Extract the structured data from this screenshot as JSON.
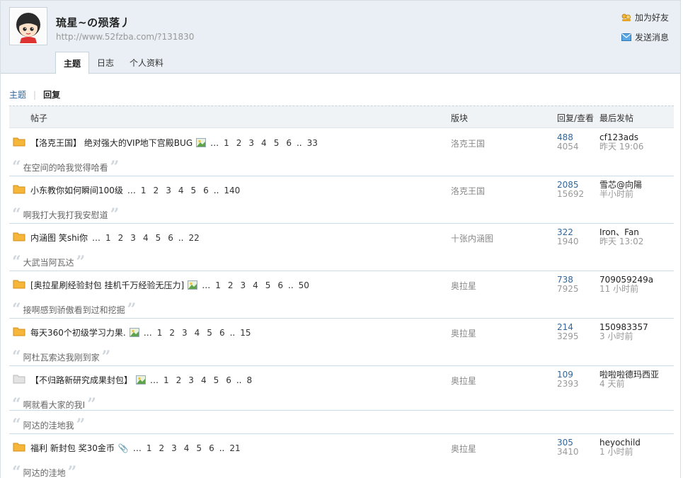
{
  "user": {
    "name": "琉星~の殒落丿",
    "url": "http://www.52fzba.com/?131830",
    "add_friend": "加为好友",
    "send_message": "发送消息"
  },
  "tabs": [
    "主题",
    "日志",
    "个人资料"
  ],
  "subnav": {
    "topics": "主题",
    "replies": "回复"
  },
  "table": {
    "headers": {
      "post": "帖子",
      "forum": "版块",
      "reply_view": "回复/查看",
      "last_post": "最后发帖"
    },
    "rows": [
      {
        "title": "【洛克王国】 绝对强大的VIP地下宫殿BUG",
        "has_image": true,
        "has_attach": false,
        "pages": [
          "1",
          "2",
          "3",
          "4",
          "5",
          "6"
        ],
        "last_page": "33",
        "forum": "洛克王国",
        "replies": "488",
        "views": "4054",
        "last_user": "cf123ads",
        "last_time": "昨天 19:06",
        "quotes": [
          "在空间的哈我觉得哈看"
        ]
      },
      {
        "title": "小东教你如何瞬间100级",
        "has_image": false,
        "has_attach": false,
        "pages": [
          "1",
          "2",
          "3",
          "4",
          "5",
          "6"
        ],
        "last_page": "140",
        "forum": "洛克王国",
        "replies": "2085",
        "views": "15692",
        "last_user": "雪芯@向陽",
        "last_time": "半小时前",
        "quotes": [
          "啊我打大我打我安慰道"
        ]
      },
      {
        "title": "内涵图 笑shi你",
        "has_image": false,
        "has_attach": false,
        "pages": [
          "1",
          "2",
          "3",
          "4",
          "5",
          "6"
        ],
        "last_page": "22",
        "forum": "十张内涵图",
        "replies": "322",
        "views": "1940",
        "last_user": "Iron、Fan",
        "last_time": "昨天 13:02",
        "quotes": [
          "大武当阿瓦达"
        ]
      },
      {
        "title": "[奥拉星刷经验封包 挂机千万经验无压力]",
        "has_image": true,
        "has_attach": false,
        "pages": [
          "1",
          "2",
          "3",
          "4",
          "5",
          "6"
        ],
        "last_page": "50",
        "forum": "奥拉星",
        "replies": "738",
        "views": "7925",
        "last_user": "709059249a",
        "last_time": "11 小时前",
        "quotes": [
          "接啊感到骄傲看到过和挖掘"
        ]
      },
      {
        "title": "每天360个初级学习力果.",
        "has_image": true,
        "has_attach": false,
        "pages": [
          "1",
          "2",
          "3",
          "4",
          "5",
          "6"
        ],
        "last_page": "15",
        "forum": "奥拉星",
        "replies": "214",
        "views": "3295",
        "last_user": "150983357",
        "last_time": "3 小时前",
        "quotes": [
          "阿杜瓦索达我刚到家"
        ]
      },
      {
        "title": "【不归路新研究成果封包】",
        "has_image": true,
        "has_attach": false,
        "pages": [
          "1",
          "2",
          "3",
          "4",
          "5",
          "6"
        ],
        "last_page": "8",
        "forum": "奥拉星",
        "replies": "109",
        "views": "2393",
        "last_user": "啦啦啦德玛西亚",
        "last_time": "4 天前",
        "quotes": [
          "啊就看大家的我I",
          "阿达的洼地我"
        ],
        "grey": true
      },
      {
        "title": "福利 新封包 奖30金币",
        "has_image": false,
        "has_attach": true,
        "pages": [
          "1",
          "2",
          "3",
          "4",
          "5",
          "6"
        ],
        "last_page": "21",
        "forum": "奥拉星",
        "replies": "305",
        "views": "3410",
        "last_user": "heyochild",
        "last_time": "1 小时前",
        "quotes": [
          "阿达的洼地"
        ]
      }
    ]
  },
  "icons": {
    "folder": "folder-icon",
    "image": "image-icon",
    "attachment": "paperclip-icon",
    "quote": "quote-icon",
    "friend": "add-friend-icon",
    "message": "envelope-icon"
  },
  "colors": {
    "link": "#336699",
    "header_bg": "#e9eff4",
    "folder": "#f5b63a"
  }
}
